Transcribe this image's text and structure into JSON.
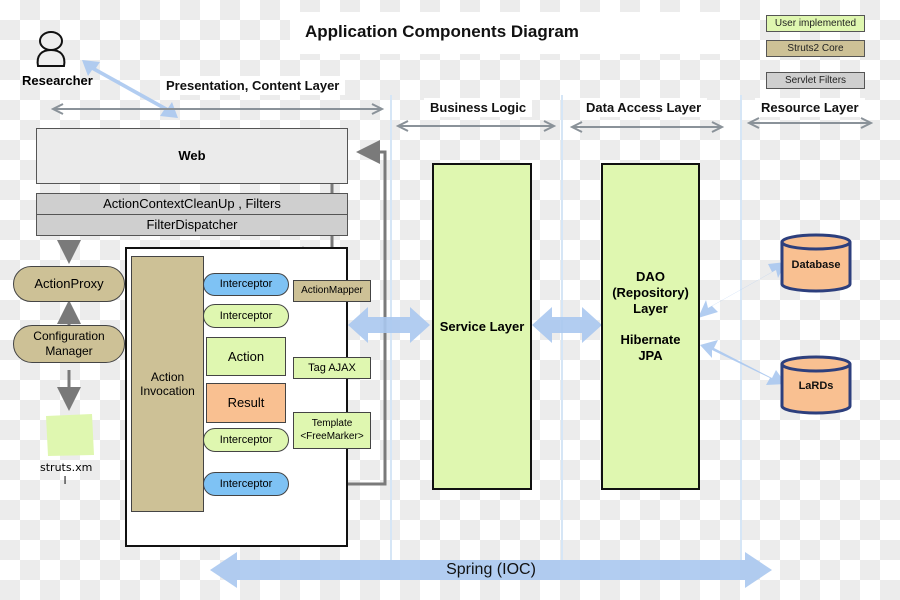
{
  "title": "Application Components Diagram",
  "legend": [
    {
      "label": "User implemented",
      "color": "#dff7b0"
    },
    {
      "label": "Struts2 Core",
      "color": "#cdc196"
    },
    {
      "label": "Servlet Filters",
      "color": "#cfcfcf"
    }
  ],
  "actor": {
    "icon": "person-icon",
    "label": "Researcher"
  },
  "layers": {
    "presentation": "Presentation, Content Layer",
    "business": "Business Logic",
    "data_access": "Data Access Layer",
    "resource": "Resource Layer"
  },
  "presentation": {
    "web": "Web",
    "filters": "ActionContextCleanUp , Filters",
    "dispatcher": "FilterDispatcher",
    "action_proxy": "ActionProxy",
    "config_manager_line1": "Configuration",
    "config_manager_line2": "Manager",
    "config_file": "struts.xm\nl",
    "config_file_line1": "struts.xm",
    "config_file_line2": "l",
    "action_invocation_line1": "Action",
    "action_invocation_line2": "Invocation",
    "interceptor_1": "Interceptor",
    "interceptor_2": "Interceptor",
    "action": "Action",
    "result": "Result",
    "interceptor_3": "Interceptor",
    "interceptor_4": "Interceptor",
    "action_mapper": "ActionMapper",
    "tag_ajax": "Tag AJAX",
    "template_line1": "Template",
    "template_line2": "<FreeMarker>"
  },
  "business": {
    "service_layer": "Service Layer"
  },
  "data_access": {
    "dao_line1": "DAO",
    "dao_line2": "(Repository)",
    "dao_line3": "Layer",
    "hibernate_line1": "Hibernate",
    "hibernate_line2": "JPA"
  },
  "resources": [
    {
      "label": "Database"
    },
    {
      "label": "LaRDs"
    }
  ],
  "spring": "Spring (IOC)",
  "colors": {
    "user_implemented": "#dff7b0",
    "struts_core": "#cdc196",
    "servlet_filters": "#cfcfcf",
    "interceptor_blue": "#7ec2f4",
    "result_orange": "#f9c091",
    "flow_arrow": "#7a7a7a",
    "layer_arrow": "#8a9299",
    "communication_arrow": "#aac8f0"
  }
}
